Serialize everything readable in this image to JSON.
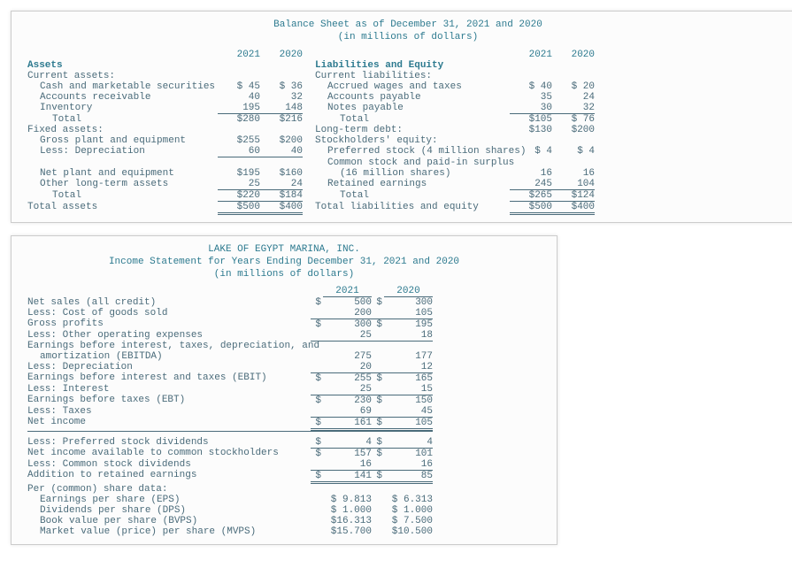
{
  "balance_sheet": {
    "title1": "Balance Sheet as of December 31, 2021 and 2020",
    "title2": "(in millions of dollars)",
    "year1": "2021",
    "year2": "2020",
    "assets_head": "Assets",
    "liab_head": "Liabilities and Equity",
    "cur_assets": "Current assets:",
    "cur_liab": "Current liabilities:",
    "cash": {
      "label": "Cash and marketable securities",
      "y1": "$ 45",
      "y2": "$ 36"
    },
    "accr": {
      "label": "Accrued wages and taxes",
      "y1": "$ 40",
      "y2": "$ 20"
    },
    "ar": {
      "label": "Accounts receivable",
      "y1": "40",
      "y2": "32"
    },
    "ap": {
      "label": "Accounts payable",
      "y1": "35",
      "y2": "24"
    },
    "inv": {
      "label": "Inventory",
      "y1": "195",
      "y2": "148"
    },
    "np": {
      "label": "Notes payable",
      "y1": "30",
      "y2": "32"
    },
    "ca_total": {
      "label": "Total",
      "y1": "$280",
      "y2": "$216"
    },
    "cl_total": {
      "label": "Total",
      "y1": "$105",
      "y2": "$ 76"
    },
    "fa_head": "Fixed assets:",
    "ltd": {
      "label": "Long-term debt:",
      "y1": "$130",
      "y2": "$200"
    },
    "gross": {
      "label": "Gross plant and equipment",
      "y1": "$255",
      "y2": "$200"
    },
    "se_head": "Stockholders' equity:",
    "dep": {
      "label": "Less: Depreciation",
      "y1": "60",
      "y2": "40"
    },
    "pref": {
      "label": "Preferred stock (4 million shares)",
      "y1": "$  4",
      "y2": "$  4"
    },
    "comm_label": "Common stock and paid-in surplus",
    "net_pe": {
      "label": "Net plant and equipment",
      "y1": "$195",
      "y2": "$160"
    },
    "comm": {
      "label": "(16 million shares)",
      "y1": "16",
      "y2": "16"
    },
    "other": {
      "label": "Other long-term assets",
      "y1": "25",
      "y2": "24"
    },
    "re": {
      "label": "Retained earnings",
      "y1": "245",
      "y2": "104"
    },
    "fa_total": {
      "label": "Total",
      "y1": "$220",
      "y2": "$184"
    },
    "se_total": {
      "label": "Total",
      "y1": "$265",
      "y2": "$124"
    },
    "ta": {
      "label": "Total assets",
      "y1": "$500",
      "y2": "$400"
    },
    "tle": {
      "label": "Total liabilities and equity",
      "y1": "$500",
      "y2": "$400"
    }
  },
  "income_statement": {
    "title1": "LAKE OF EGYPT MARINA, INC.",
    "title2": "Income Statement for Years Ending December 31, 2021 and 2020",
    "title3": "(in millions of dollars)",
    "year1": "2021",
    "year2": "2020",
    "rows": [
      {
        "label": "Net sales (all credit)",
        "s1": "$",
        "v1": "500",
        "s2": "$",
        "v2": "300",
        "bt": false,
        "db": false,
        "indent": 0
      },
      {
        "label": "Less: Cost of goods sold",
        "s1": "",
        "v1": "200",
        "s2": "",
        "v2": "105",
        "bt": false,
        "db": false,
        "indent": 0
      },
      {
        "label": "Gross profits",
        "s1": "$",
        "v1": "300",
        "s2": "$",
        "v2": "195",
        "bt": true,
        "db": false,
        "indent": 0
      },
      {
        "label": "Less: Other operating expenses",
        "s1": "",
        "v1": "25",
        "s2": "",
        "v2": "18",
        "bt": false,
        "db": false,
        "indent": 0
      },
      {
        "label": "Earnings before interest, taxes, depreciation, and",
        "s1": "",
        "v1": "",
        "s2": "",
        "v2": "",
        "bt": true,
        "db": false,
        "indent": 0
      },
      {
        "label": "amortization (EBITDA)",
        "s1": "",
        "v1": "275",
        "s2": "",
        "v2": "177",
        "bt": false,
        "db": false,
        "indent": 1
      },
      {
        "label": "Less: Depreciation",
        "s1": "",
        "v1": "20",
        "s2": "",
        "v2": "12",
        "bt": false,
        "db": false,
        "indent": 0
      },
      {
        "label": "Earnings before interest and taxes (EBIT)",
        "s1": "$",
        "v1": "255",
        "s2": "$",
        "v2": "165",
        "bt": true,
        "db": false,
        "indent": 0
      },
      {
        "label": "Less: Interest",
        "s1": "",
        "v1": "25",
        "s2": "",
        "v2": "15",
        "bt": false,
        "db": false,
        "indent": 0
      },
      {
        "label": "Earnings before taxes (EBT)",
        "s1": "$",
        "v1": "230",
        "s2": "$",
        "v2": "150",
        "bt": true,
        "db": false,
        "indent": 0
      },
      {
        "label": "Less: Taxes",
        "s1": "",
        "v1": "69",
        "s2": "",
        "v2": "45",
        "bt": false,
        "db": false,
        "indent": 0
      },
      {
        "label": "Net income",
        "s1": "$",
        "v1": "161",
        "s2": "$",
        "v2": "105",
        "bt": true,
        "db": true,
        "indent": 0
      },
      {
        "label": "Less: Preferred stock dividends",
        "s1": "$",
        "v1": "4",
        "s2": "$",
        "v2": "4",
        "bt": false,
        "db": false,
        "indent": 0,
        "sep_above": true
      },
      {
        "label": "Net income available to common stockholders",
        "s1": "$",
        "v1": "157",
        "s2": "$",
        "v2": "101",
        "bt": true,
        "db": false,
        "indent": 0
      },
      {
        "label": "Less: Common stock dividends",
        "s1": "",
        "v1": "16",
        "s2": "",
        "v2": "16",
        "bt": false,
        "db": false,
        "indent": 0
      },
      {
        "label": "Addition to retained earnings",
        "s1": "$",
        "v1": "141",
        "s2": "$",
        "v2": "85",
        "bt": true,
        "db": true,
        "indent": 0
      },
      {
        "label": "Per (common) share data:",
        "s1": "",
        "v1": "",
        "s2": "",
        "v2": "",
        "bt": false,
        "db": false,
        "indent": 0
      },
      {
        "label": "Earnings per share (EPS)",
        "s1": "",
        "v1": "$ 9.813",
        "s2": "",
        "v2": "$ 6.313",
        "bt": false,
        "db": false,
        "indent": 1
      },
      {
        "label": "Dividends per share (DPS)",
        "s1": "",
        "v1": "$ 1.000",
        "s2": "",
        "v2": "$ 1.000",
        "bt": false,
        "db": false,
        "indent": 1
      },
      {
        "label": "Book value per share (BVPS)",
        "s1": "",
        "v1": "$16.313",
        "s2": "",
        "v2": "$ 7.500",
        "bt": false,
        "db": false,
        "indent": 1
      },
      {
        "label": "Market value (price) per share (MVPS)",
        "s1": "",
        "v1": "$15.700",
        "s2": "",
        "v2": "$10.500",
        "bt": false,
        "db": false,
        "indent": 1
      }
    ]
  }
}
